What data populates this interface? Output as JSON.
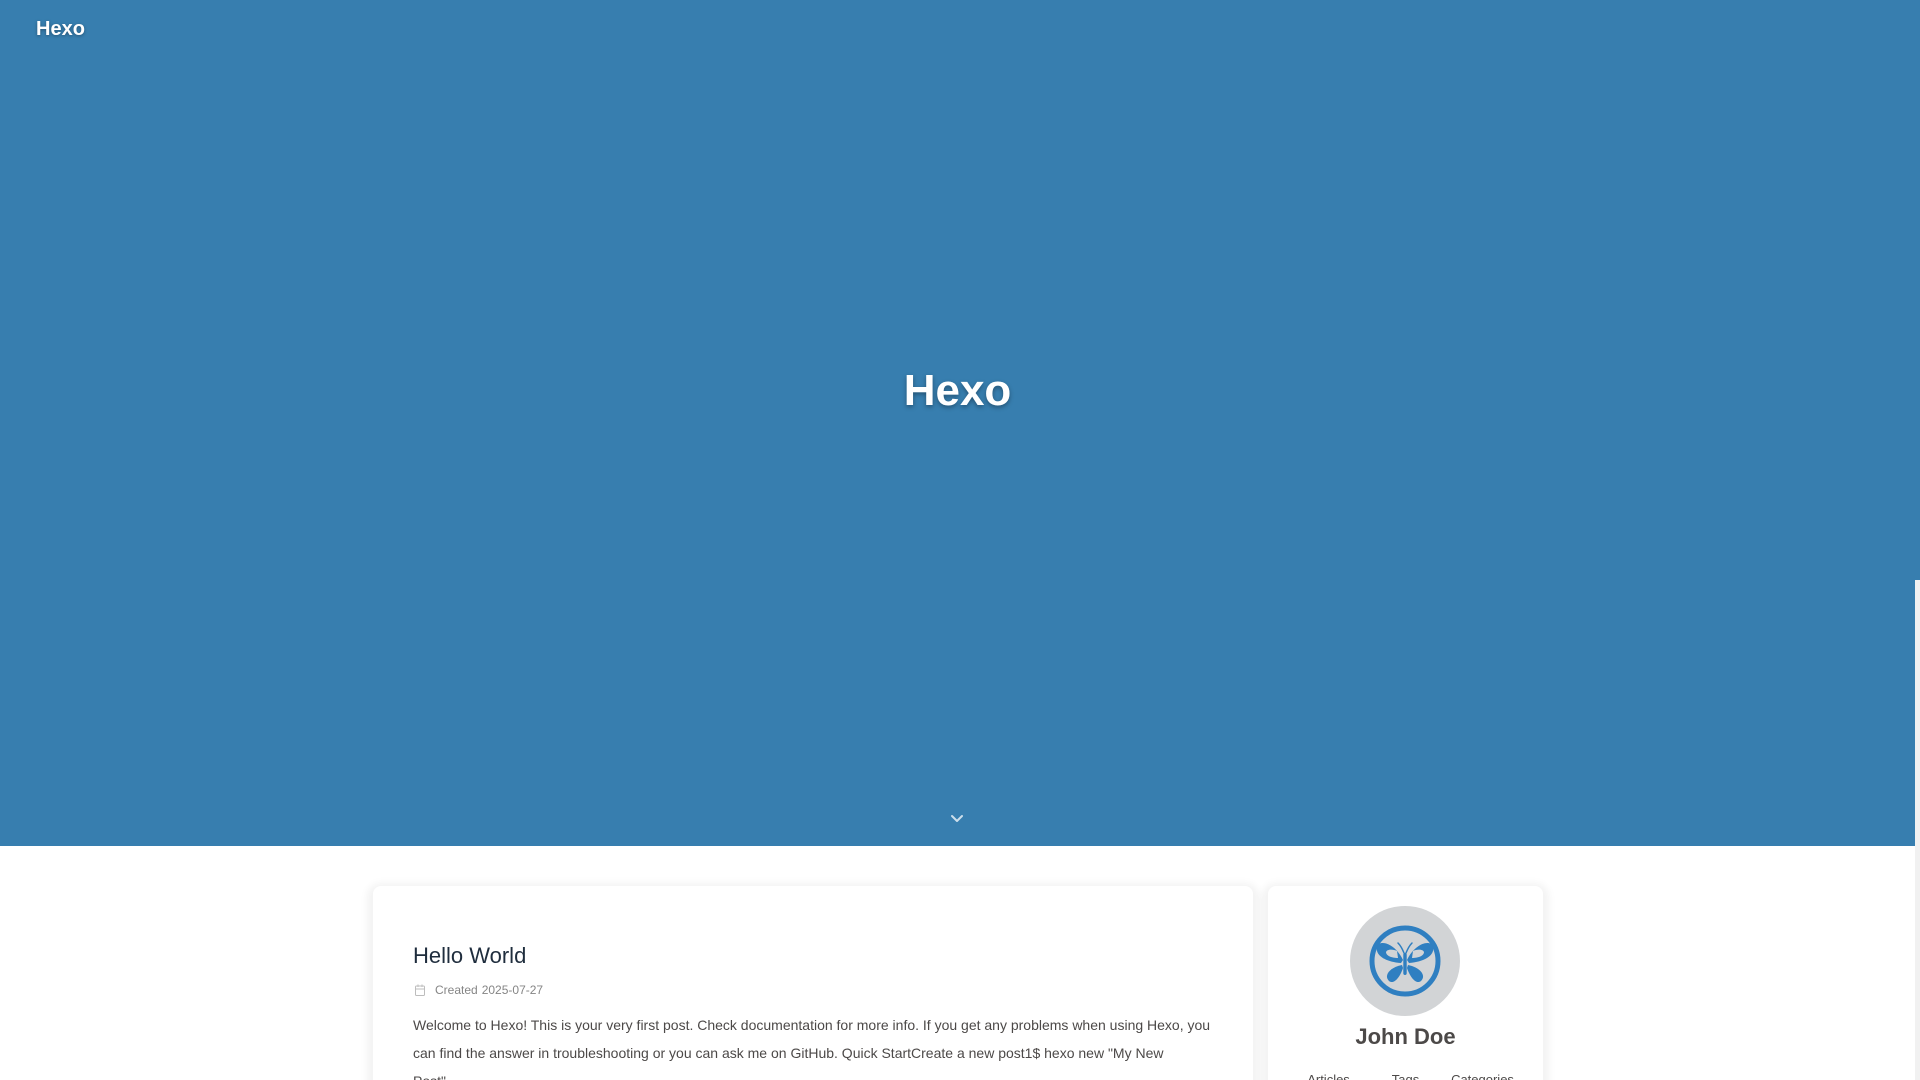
{
  "header": {
    "site_name": "Hexo"
  },
  "hero": {
    "title": "Hexo"
  },
  "post": {
    "title": "Hello World",
    "meta_label": "Created",
    "date": "2025-07-27",
    "excerpt": "Welcome to Hexo! This is your very first post. Check documentation for more info. If you get any problems when using Hexo, you can find the answer in troubleshooting or you can ask me on GitHub. Quick StartCreate a new post1$ hexo new \"My New Post\"…"
  },
  "author": {
    "name": "John Doe",
    "stats": [
      {
        "label": "Articles"
      },
      {
        "label": "Tags"
      },
      {
        "label": "Categories"
      }
    ]
  },
  "colors": {
    "hero_background": "#377eaf",
    "text_dark": "#4c4948",
    "title_dark": "#1f2d3d",
    "meta_gray": "#858585",
    "avatar_background": "#d2d4d6",
    "butterfly_blue": "#2f7fc1"
  },
  "icons": {
    "scroll_down": "chevron-down-icon",
    "date": "calendar-icon",
    "avatar": "butterfly-icon"
  }
}
